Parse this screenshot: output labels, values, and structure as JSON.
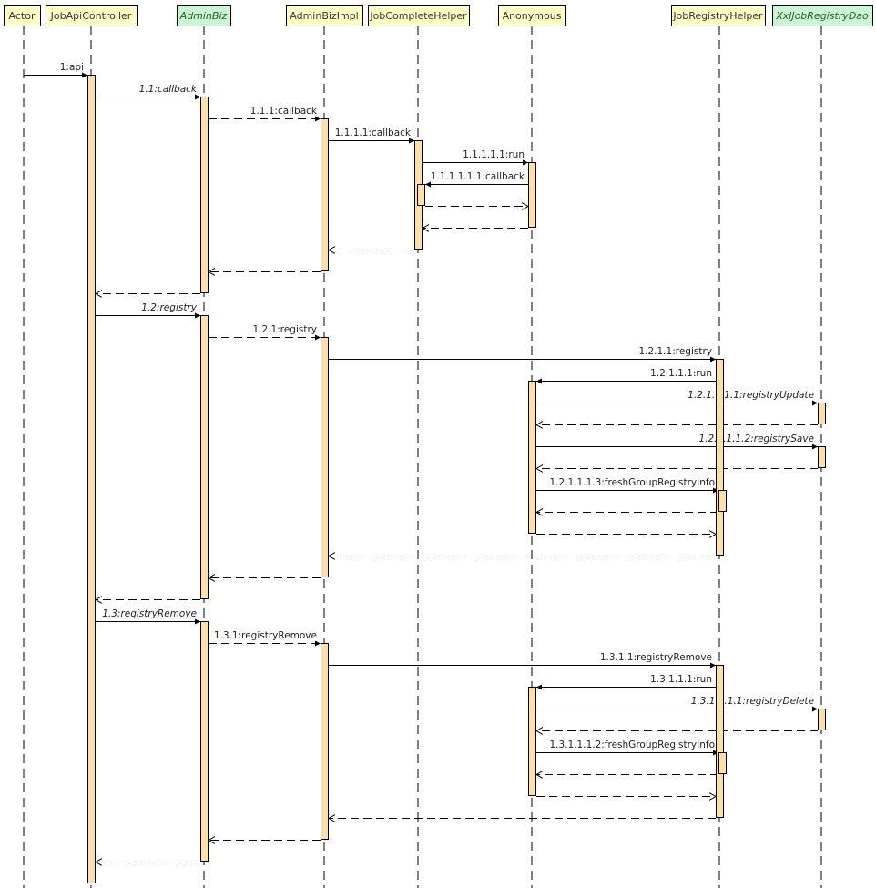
{
  "diagram": {
    "type": "uml-sequence",
    "colors": {
      "participant_fill": "#ffffc8",
      "interface_fill": "#ccf5d4",
      "activation_fill": "#fce0a8",
      "line": "#000000"
    },
    "participants": [
      {
        "id": "actor",
        "name": "Actor",
        "kind": "actor"
      },
      {
        "id": "jobapicontroller",
        "name": "JobApiController",
        "kind": "class"
      },
      {
        "id": "adminbiz",
        "name": "AdminBiz",
        "kind": "interface"
      },
      {
        "id": "adminbizimpl",
        "name": "AdminBizImpl",
        "kind": "class"
      },
      {
        "id": "jobcompletehelper",
        "name": "JobCompleteHelper",
        "kind": "class"
      },
      {
        "id": "anonymous",
        "name": "Anonymous",
        "kind": "class"
      },
      {
        "id": "jobregistryhelper",
        "name": "JobRegistryHelper",
        "kind": "class"
      },
      {
        "id": "xxljobregistrydao",
        "name": "XxlJobRegistryDao",
        "kind": "interface"
      }
    ],
    "messages": [
      {
        "label": "1:api",
        "from": "actor",
        "to": "jobapicontroller",
        "style": "call",
        "italic": false
      },
      {
        "label": "1.1:callback",
        "from": "jobapicontroller",
        "to": "adminbiz",
        "style": "call",
        "italic": true
      },
      {
        "label": "1.1.1:callback",
        "from": "adminbiz",
        "to": "adminbizimpl",
        "style": "dashed-call",
        "italic": false
      },
      {
        "label": "1.1.1.1:callback",
        "from": "adminbizimpl",
        "to": "jobcompletehelper",
        "style": "call",
        "italic": false
      },
      {
        "label": "1.1.1.1.1:run",
        "from": "jobcompletehelper",
        "to": "anonymous",
        "style": "call",
        "italic": false
      },
      {
        "label": "1.1.1.1.1.1:callback",
        "from": "anonymous",
        "to": "jobcompletehelper",
        "style": "call",
        "italic": false
      },
      {
        "label": "",
        "from": "jobcompletehelper",
        "to": "anonymous",
        "style": "return",
        "italic": false
      },
      {
        "label": "",
        "from": "anonymous",
        "to": "jobcompletehelper",
        "style": "return",
        "italic": false
      },
      {
        "label": "",
        "from": "jobcompletehelper",
        "to": "adminbizimpl",
        "style": "return",
        "italic": false
      },
      {
        "label": "",
        "from": "adminbizimpl",
        "to": "adminbiz",
        "style": "return",
        "italic": false
      },
      {
        "label": "",
        "from": "adminbiz",
        "to": "jobapicontroller",
        "style": "return",
        "italic": false
      },
      {
        "label": "1.2:registry",
        "from": "jobapicontroller",
        "to": "adminbiz",
        "style": "call",
        "italic": true
      },
      {
        "label": "1.2.1:registry",
        "from": "adminbiz",
        "to": "adminbizimpl",
        "style": "dashed-call",
        "italic": false
      },
      {
        "label": "1.2.1.1:registry",
        "from": "adminbizimpl",
        "to": "jobregistryhelper",
        "style": "call",
        "italic": false
      },
      {
        "label": "1.2.1.1.1:run",
        "from": "jobregistryhelper",
        "to": "anonymous",
        "style": "call",
        "italic": false
      },
      {
        "label": "1.2.1.1.1.1:registryUpdate",
        "from": "anonymous",
        "to": "xxljobregistrydao",
        "style": "call",
        "italic": true
      },
      {
        "label": "",
        "from": "xxljobregistrydao",
        "to": "anonymous",
        "style": "return",
        "italic": false
      },
      {
        "label": "1.2.1.1.1.2:registrySave",
        "from": "anonymous",
        "to": "xxljobregistrydao",
        "style": "call",
        "italic": true
      },
      {
        "label": "",
        "from": "xxljobregistrydao",
        "to": "anonymous",
        "style": "return",
        "italic": false
      },
      {
        "label": "1.2.1.1.1.3:freshGroupRegistryInfo",
        "from": "anonymous",
        "to": "jobregistryhelper",
        "style": "call",
        "italic": false
      },
      {
        "label": "",
        "from": "jobregistryhelper",
        "to": "anonymous",
        "style": "return",
        "italic": false
      },
      {
        "label": "",
        "from": "anonymous",
        "to": "jobregistryhelper",
        "style": "return",
        "italic": false
      },
      {
        "label": "",
        "from": "jobregistryhelper",
        "to": "adminbizimpl",
        "style": "return",
        "italic": false
      },
      {
        "label": "",
        "from": "adminbizimpl",
        "to": "adminbiz",
        "style": "return",
        "italic": false
      },
      {
        "label": "",
        "from": "adminbiz",
        "to": "jobapicontroller",
        "style": "return",
        "italic": false
      },
      {
        "label": "1.3:registryRemove",
        "from": "jobapicontroller",
        "to": "adminbiz",
        "style": "call",
        "italic": true
      },
      {
        "label": "1.3.1:registryRemove",
        "from": "adminbiz",
        "to": "adminbizimpl",
        "style": "dashed-call",
        "italic": false
      },
      {
        "label": "1.3.1.1:registryRemove",
        "from": "adminbizimpl",
        "to": "jobregistryhelper",
        "style": "call",
        "italic": false
      },
      {
        "label": "1.3.1.1.1:run",
        "from": "jobregistryhelper",
        "to": "anonymous",
        "style": "call",
        "italic": false
      },
      {
        "label": "1.3.1.1.1.1:registryDelete",
        "from": "anonymous",
        "to": "xxljobregistrydao",
        "style": "call",
        "italic": true
      },
      {
        "label": "",
        "from": "xxljobregistrydao",
        "to": "anonymous",
        "style": "return",
        "italic": false
      },
      {
        "label": "1.3.1.1.1.2:freshGroupRegistryInfo",
        "from": "anonymous",
        "to": "jobregistryhelper",
        "style": "call",
        "italic": false
      },
      {
        "label": "",
        "from": "jobregistryhelper",
        "to": "anonymous",
        "style": "return",
        "italic": false
      },
      {
        "label": "",
        "from": "anonymous",
        "to": "jobregistryhelper",
        "style": "return",
        "italic": false
      },
      {
        "label": "",
        "from": "jobregistryhelper",
        "to": "adminbizimpl",
        "style": "return",
        "italic": false
      },
      {
        "label": "",
        "from": "adminbizimpl",
        "to": "adminbiz",
        "style": "return",
        "italic": false
      },
      {
        "label": "",
        "from": "adminbiz",
        "to": "jobapicontroller",
        "style": "return",
        "italic": false
      }
    ]
  }
}
